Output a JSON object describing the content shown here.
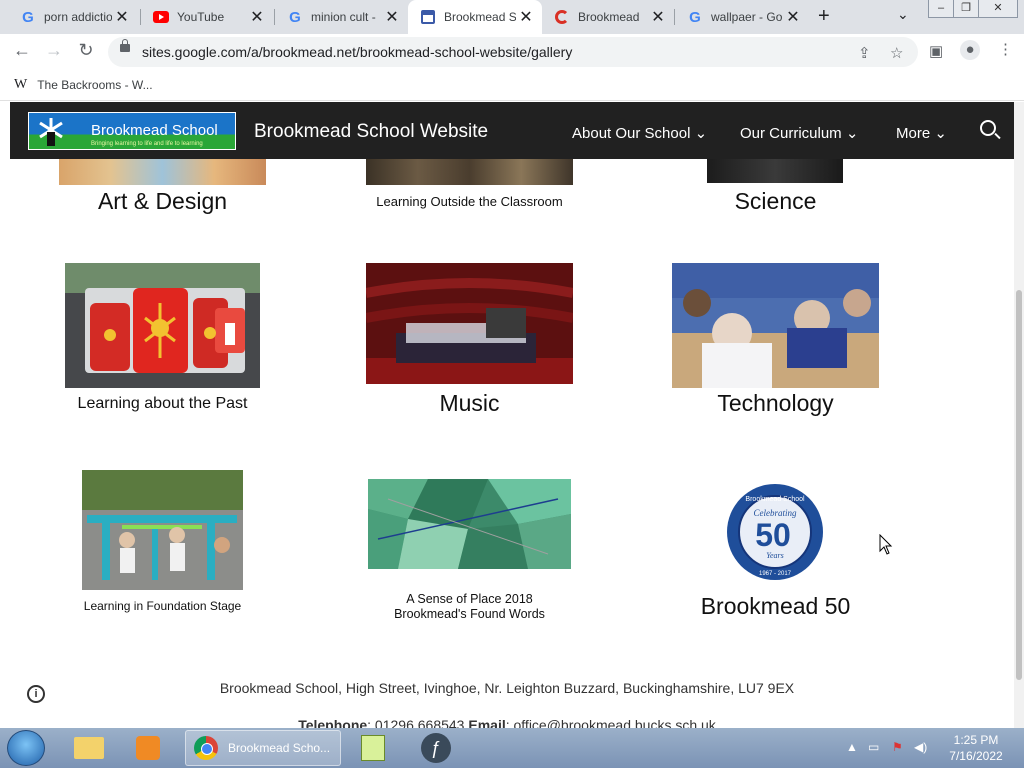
{
  "browser": {
    "tabs": [
      {
        "title": "porn addictio",
        "icon": "google-icon"
      },
      {
        "title": "YouTube",
        "icon": "youtube-icon"
      },
      {
        "title": "minion cult -",
        "icon": "google-icon"
      },
      {
        "title": "Brookmead S",
        "icon": "sites-icon",
        "active": true
      },
      {
        "title": "Brookmead",
        "icon": "red-loading-icon"
      },
      {
        "title": "wallpaer - Go",
        "icon": "google-icon"
      }
    ],
    "url": "sites.google.com/a/brookmead.net/brookmead-school-website/gallery",
    "bookmark": "The Backrooms - W..."
  },
  "site": {
    "logo_text": "Brookmead School",
    "logo_tagline": "Bringing learning to life and life to learning",
    "title": "Brookmead School Website",
    "nav": [
      "About Our School",
      "Our Curriculum",
      "More"
    ]
  },
  "gallery": [
    {
      "caption": "Art & Design"
    },
    {
      "caption": "Learning Outside the Classroom"
    },
    {
      "caption": "Science"
    },
    {
      "caption": "Learning about the Past"
    },
    {
      "caption": "Music"
    },
    {
      "caption": "Technology"
    },
    {
      "caption": "Learning in Foundation Stage"
    },
    {
      "caption": "A Sense of Place 2018",
      "caption2": "Brookmead's Found Words"
    },
    {
      "caption": "Brookmead 50"
    }
  ],
  "badge": {
    "top": "Brookmead School",
    "middle": "Celebrating",
    "number": "50",
    "sub": "Years",
    "years": "1967 - 2017"
  },
  "footer": {
    "address": "Brookmead School, High Street, Ivinghoe, Nr. Leighton Buzzard, Buckinghamshire, LU7 9EX",
    "tel_label": "Telephone",
    "tel": ": 01296 668543",
    "email_label": "Email",
    "email": ": office@brookmead.bucks.sch.uk"
  },
  "taskbar": {
    "active_app": "Brookmead Scho...",
    "time": "1:25 PM",
    "date": "7/16/2022"
  }
}
